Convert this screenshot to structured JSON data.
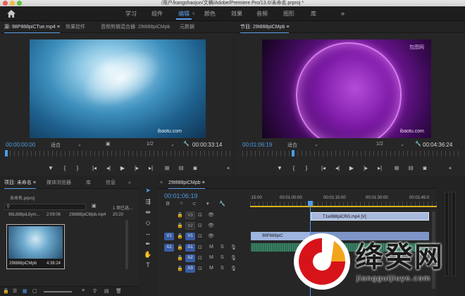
{
  "titlebar": {
    "title": "/用户/kangshaojun/文稿/Adobe/Premiere Pro/13.0/未命名.prproj *"
  },
  "workspace": {
    "tabs": [
      {
        "label": "学习",
        "active": false
      },
      {
        "label": "组件",
        "active": false
      },
      {
        "label": "编辑",
        "active": true
      },
      {
        "label": "颜色",
        "active": false
      },
      {
        "label": "效果",
        "active": false
      },
      {
        "label": "音频",
        "active": false
      },
      {
        "label": "图形",
        "active": false
      },
      {
        "label": "库",
        "active": false
      }
    ],
    "more": "»"
  },
  "source_panel": {
    "tabs": [
      "源: 98P888piCTue.mp4 ≡",
      "效果控件",
      "音频剪辑混合器: 29t888piCMpb",
      "元数据"
    ],
    "watermark": "ibaotu.com",
    "timecode_in": "00:00:00:00",
    "fit": "适合",
    "quality": "1/2",
    "timecode_dur": "00:00:33:14"
  },
  "program_panel": {
    "tabs": [
      "节目: 29t888piCMpb ≡"
    ],
    "watermark": "ibaotu.com",
    "watermark2": "包图网",
    "timecode_in": "00:01:06:19",
    "fit": "适合",
    "quality": "1/2",
    "timecode_dur": "00:04:36:24"
  },
  "project_panel": {
    "tabs": [
      "项目: 未命名 ≡",
      "媒体浏览器",
      "库",
      "信息",
      "»"
    ],
    "file": "未命名.prproj",
    "search_placeholder": "",
    "selected_count": "1 项已选...",
    "list_row": {
      "name": "98L888piL8ym...",
      "dur": "2:09:06",
      "name2": "29t888piCMpb.mp4",
      "dur2": "20:20"
    },
    "thumb": {
      "name": "29t888piCMpb",
      "dur": "4:36:24"
    }
  },
  "timeline": {
    "tab": "29t888piCMpb ≡",
    "timecode": "00:01:06:19",
    "ruler": [
      ":15:00",
      "00:01:00:00",
      "00:01:15:00",
      "00:01:30:00",
      "00:01:45:0"
    ],
    "video_tracks": [
      "V3",
      "V2",
      "V1"
    ],
    "audio_tracks": [
      "A1",
      "A2",
      "A3"
    ],
    "src_v": "V1",
    "src_a": "A1",
    "clip_v_a": "98P888piC",
    "clip_v_b": "T1w888piCRG.mp4 [V]"
  },
  "logo": {
    "title": "绛癸网",
    "url": "jiangguijiuye.com"
  },
  "colors": {
    "accent": "#5a9de8",
    "timecode": "#4e9ce6",
    "playhead": "#4e9ce6"
  }
}
